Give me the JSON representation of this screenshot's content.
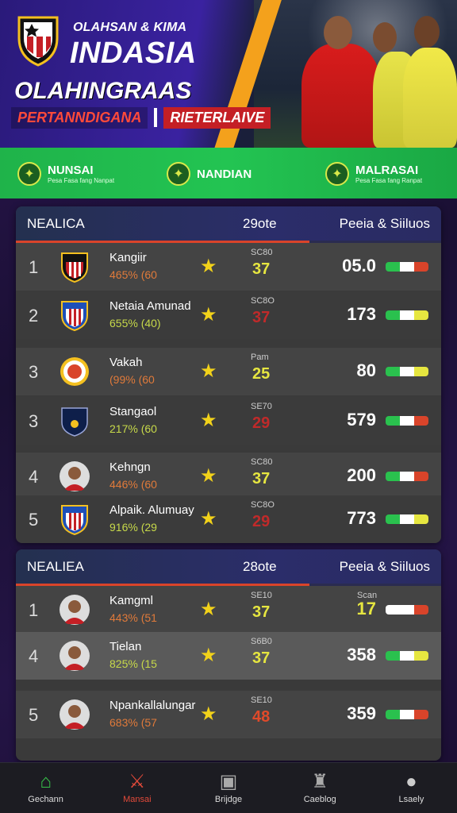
{
  "hero": {
    "subtitle": "OLAHSAN & KIMA",
    "title": "INDASIA",
    "tagline": "OLAHINGRAAS",
    "pill_left": "PERTANNDIGANA",
    "pill_right": "RIETERLAIVE"
  },
  "strip": [
    {
      "title": "NUNSAI",
      "small": "Pesa Fasa fang Nanpat",
      "icon": "shield-icon"
    },
    {
      "title": "NANDIAN",
      "small": "",
      "icon": "shield-icon"
    },
    {
      "title": "MALRASAI",
      "small": "Pesa Fasa fang Ranpat",
      "icon": "shield-icon"
    }
  ],
  "panel_a": {
    "headers": [
      "NEALICA",
      "29ote",
      "Peeia & Siiluos"
    ],
    "rows": [
      {
        "rank": "1",
        "name": "Kangiir",
        "pct": "465% (60",
        "slabel": "SC80",
        "score": "37",
        "score_color": "#e6e640",
        "value": "05.0",
        "logo": "crest-red",
        "flag": [
          "#2ac14e",
          "#ffffff",
          "#d9442a"
        ]
      },
      {
        "rank": "2",
        "name": "Netaia Amunad",
        "pct": "655% (40)",
        "slabel": "SC8O",
        "score": "37",
        "score_color": "#c02a2a",
        "value": "173",
        "logo": "crest-blue",
        "flag": [
          "#2ac14e",
          "#ffffff",
          "#e6e640"
        ]
      },
      {
        "rank": "3",
        "name": "Vakah",
        "pct": "(99% (60",
        "slabel": "Pam",
        "score": "25",
        "score_color": "#e6e640",
        "value": "80",
        "logo": "badge-red",
        "flag": [
          "#2ac14e",
          "#ffffff",
          "#e6e640"
        ]
      },
      {
        "rank": "3",
        "name": "Stangaol",
        "pct": "217% (60",
        "slabel": "SE70",
        "score": "29",
        "score_color": "#c02a2a",
        "value": "579",
        "logo": "badge-navy",
        "flag": [
          "#2ac14e",
          "#ffffff",
          "#d9442a"
        ]
      },
      {
        "rank": "4",
        "name": "Kehngn",
        "pct": "446% (60",
        "slabel": "SC80",
        "score": "37",
        "score_color": "#e6e640",
        "value": "200",
        "logo": "avatar",
        "flag": [
          "#2ac14e",
          "#ffffff",
          "#d9442a"
        ]
      },
      {
        "rank": "5",
        "name": "Alpaik. Alumuay",
        "pct": "916% (29",
        "slabel": "SC8O",
        "score": "29",
        "score_color": "#c02a2a",
        "value": "773",
        "logo": "crest-blue",
        "flag": [
          "#2ac14e",
          "#ffffff",
          "#e6e640"
        ]
      }
    ]
  },
  "panel_b": {
    "headers": [
      "NEALIEA",
      "28ote",
      "Peeia & Siiluos"
    ],
    "rows": [
      {
        "rank": "1",
        "name": "Kamgml",
        "pct": "443% (51",
        "slabel": "SE10",
        "score": "37",
        "score_color": "#e6e640",
        "value_label": "Scan",
        "value": "17",
        "value_color": "#e6e640",
        "logo": "avatar",
        "flag": [
          "#ffffff",
          "#ffffff",
          "#d9442a"
        ]
      },
      {
        "rank": "4",
        "name": "Tielan",
        "pct": "825% (15",
        "slabel": "S6B0",
        "score": "37",
        "score_color": "#e6e640",
        "value": "358",
        "value_color": "#ffffff",
        "logo": "avatar",
        "flag": [
          "#2ac14e",
          "#ffffff",
          "#e6e640"
        ]
      },
      {
        "rank": "5",
        "name": "Npankallalungar",
        "pct": "683% (57",
        "slabel": "SE10",
        "score": "48",
        "score_color": "#e04a2a",
        "value": "359",
        "value_color": "#ffffff",
        "logo": "avatar",
        "flag": [
          "#2ac14e",
          "#ffffff",
          "#d9442a"
        ]
      }
    ]
  },
  "nav": [
    {
      "label": "Gechann",
      "icon": "home-icon",
      "color": "#37c24a"
    },
    {
      "label": "Mansai",
      "icon": "swords-icon",
      "color": "#e24a3a"
    },
    {
      "label": "Brijdge",
      "icon": "lock-icon",
      "color": "#aaaaaa"
    },
    {
      "label": "Caeblog",
      "icon": "trophy-icon",
      "color": "#aaaaaa"
    },
    {
      "label": "Lsaely",
      "icon": "user-icon",
      "color": "#cccccc"
    }
  ]
}
